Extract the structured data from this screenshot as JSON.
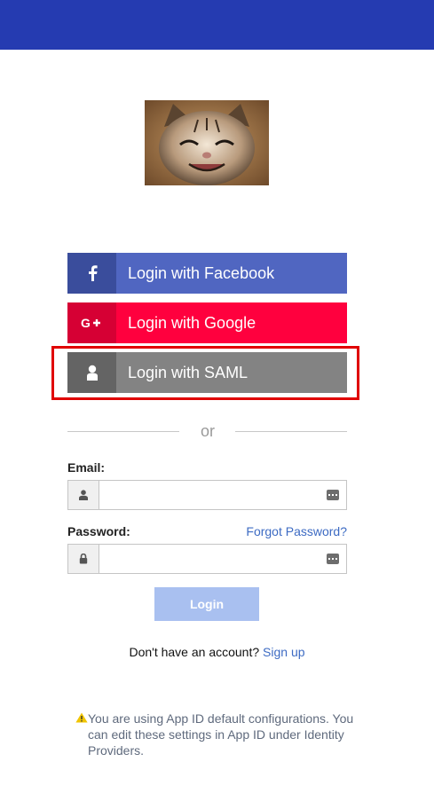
{
  "header": {
    "color": "#253bb1"
  },
  "logo": {
    "alt": "kitten"
  },
  "sso": {
    "facebook": {
      "label": "Login with Facebook",
      "icon": "facebook-icon",
      "color": "#5066c1"
    },
    "google": {
      "label": "Login with Google",
      "icon": "google-plus-icon",
      "color": "#ff003e"
    },
    "saml": {
      "label": "Login with SAML",
      "icon": "user-icon",
      "color": "#838383"
    }
  },
  "divider": {
    "text": "or"
  },
  "form": {
    "email": {
      "label": "Email:",
      "value": "",
      "icon": "user-icon"
    },
    "password": {
      "label": "Password:",
      "value": "",
      "icon": "lock-icon"
    },
    "forgot_label": "Forgot Password?",
    "submit_label": "Login"
  },
  "signup": {
    "prompt": "Don't have an account?",
    "link": "Sign up"
  },
  "notice": {
    "icon": "warning-icon",
    "text": "You are using App ID default configurations. You can edit these settings in App ID under Identity Providers."
  }
}
